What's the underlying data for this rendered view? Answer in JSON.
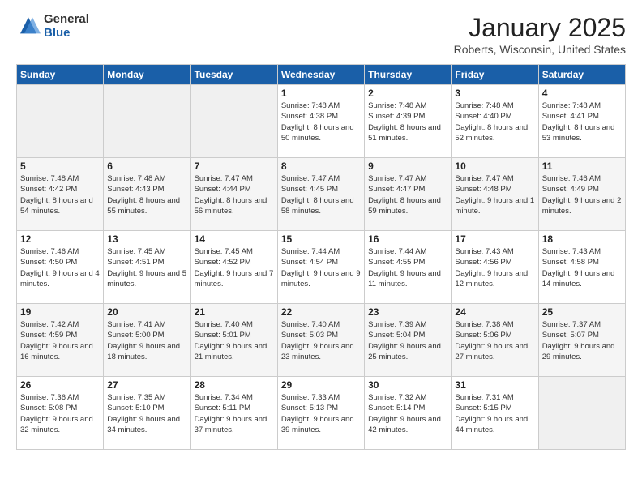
{
  "logo": {
    "general": "General",
    "blue": "Blue"
  },
  "header": {
    "month": "January 2025",
    "location": "Roberts, Wisconsin, United States"
  },
  "weekdays": [
    "Sunday",
    "Monday",
    "Tuesday",
    "Wednesday",
    "Thursday",
    "Friday",
    "Saturday"
  ],
  "weeks": [
    [
      {
        "day": "",
        "sunrise": "",
        "sunset": "",
        "daylight": ""
      },
      {
        "day": "",
        "sunrise": "",
        "sunset": "",
        "daylight": ""
      },
      {
        "day": "",
        "sunrise": "",
        "sunset": "",
        "daylight": ""
      },
      {
        "day": "1",
        "sunrise": "Sunrise: 7:48 AM",
        "sunset": "Sunset: 4:38 PM",
        "daylight": "Daylight: 8 hours and 50 minutes."
      },
      {
        "day": "2",
        "sunrise": "Sunrise: 7:48 AM",
        "sunset": "Sunset: 4:39 PM",
        "daylight": "Daylight: 8 hours and 51 minutes."
      },
      {
        "day": "3",
        "sunrise": "Sunrise: 7:48 AM",
        "sunset": "Sunset: 4:40 PM",
        "daylight": "Daylight: 8 hours and 52 minutes."
      },
      {
        "day": "4",
        "sunrise": "Sunrise: 7:48 AM",
        "sunset": "Sunset: 4:41 PM",
        "daylight": "Daylight: 8 hours and 53 minutes."
      }
    ],
    [
      {
        "day": "5",
        "sunrise": "Sunrise: 7:48 AM",
        "sunset": "Sunset: 4:42 PM",
        "daylight": "Daylight: 8 hours and 54 minutes."
      },
      {
        "day": "6",
        "sunrise": "Sunrise: 7:48 AM",
        "sunset": "Sunset: 4:43 PM",
        "daylight": "Daylight: 8 hours and 55 minutes."
      },
      {
        "day": "7",
        "sunrise": "Sunrise: 7:47 AM",
        "sunset": "Sunset: 4:44 PM",
        "daylight": "Daylight: 8 hours and 56 minutes."
      },
      {
        "day": "8",
        "sunrise": "Sunrise: 7:47 AM",
        "sunset": "Sunset: 4:45 PM",
        "daylight": "Daylight: 8 hours and 58 minutes."
      },
      {
        "day": "9",
        "sunrise": "Sunrise: 7:47 AM",
        "sunset": "Sunset: 4:47 PM",
        "daylight": "Daylight: 8 hours and 59 minutes."
      },
      {
        "day": "10",
        "sunrise": "Sunrise: 7:47 AM",
        "sunset": "Sunset: 4:48 PM",
        "daylight": "Daylight: 9 hours and 1 minute."
      },
      {
        "day": "11",
        "sunrise": "Sunrise: 7:46 AM",
        "sunset": "Sunset: 4:49 PM",
        "daylight": "Daylight: 9 hours and 2 minutes."
      }
    ],
    [
      {
        "day": "12",
        "sunrise": "Sunrise: 7:46 AM",
        "sunset": "Sunset: 4:50 PM",
        "daylight": "Daylight: 9 hours and 4 minutes."
      },
      {
        "day": "13",
        "sunrise": "Sunrise: 7:45 AM",
        "sunset": "Sunset: 4:51 PM",
        "daylight": "Daylight: 9 hours and 5 minutes."
      },
      {
        "day": "14",
        "sunrise": "Sunrise: 7:45 AM",
        "sunset": "Sunset: 4:52 PM",
        "daylight": "Daylight: 9 hours and 7 minutes."
      },
      {
        "day": "15",
        "sunrise": "Sunrise: 7:44 AM",
        "sunset": "Sunset: 4:54 PM",
        "daylight": "Daylight: 9 hours and 9 minutes."
      },
      {
        "day": "16",
        "sunrise": "Sunrise: 7:44 AM",
        "sunset": "Sunset: 4:55 PM",
        "daylight": "Daylight: 9 hours and 11 minutes."
      },
      {
        "day": "17",
        "sunrise": "Sunrise: 7:43 AM",
        "sunset": "Sunset: 4:56 PM",
        "daylight": "Daylight: 9 hours and 12 minutes."
      },
      {
        "day": "18",
        "sunrise": "Sunrise: 7:43 AM",
        "sunset": "Sunset: 4:58 PM",
        "daylight": "Daylight: 9 hours and 14 minutes."
      }
    ],
    [
      {
        "day": "19",
        "sunrise": "Sunrise: 7:42 AM",
        "sunset": "Sunset: 4:59 PM",
        "daylight": "Daylight: 9 hours and 16 minutes."
      },
      {
        "day": "20",
        "sunrise": "Sunrise: 7:41 AM",
        "sunset": "Sunset: 5:00 PM",
        "daylight": "Daylight: 9 hours and 18 minutes."
      },
      {
        "day": "21",
        "sunrise": "Sunrise: 7:40 AM",
        "sunset": "Sunset: 5:01 PM",
        "daylight": "Daylight: 9 hours and 21 minutes."
      },
      {
        "day": "22",
        "sunrise": "Sunrise: 7:40 AM",
        "sunset": "Sunset: 5:03 PM",
        "daylight": "Daylight: 9 hours and 23 minutes."
      },
      {
        "day": "23",
        "sunrise": "Sunrise: 7:39 AM",
        "sunset": "Sunset: 5:04 PM",
        "daylight": "Daylight: 9 hours and 25 minutes."
      },
      {
        "day": "24",
        "sunrise": "Sunrise: 7:38 AM",
        "sunset": "Sunset: 5:06 PM",
        "daylight": "Daylight: 9 hours and 27 minutes."
      },
      {
        "day": "25",
        "sunrise": "Sunrise: 7:37 AM",
        "sunset": "Sunset: 5:07 PM",
        "daylight": "Daylight: 9 hours and 29 minutes."
      }
    ],
    [
      {
        "day": "26",
        "sunrise": "Sunrise: 7:36 AM",
        "sunset": "Sunset: 5:08 PM",
        "daylight": "Daylight: 9 hours and 32 minutes."
      },
      {
        "day": "27",
        "sunrise": "Sunrise: 7:35 AM",
        "sunset": "Sunset: 5:10 PM",
        "daylight": "Daylight: 9 hours and 34 minutes."
      },
      {
        "day": "28",
        "sunrise": "Sunrise: 7:34 AM",
        "sunset": "Sunset: 5:11 PM",
        "daylight": "Daylight: 9 hours and 37 minutes."
      },
      {
        "day": "29",
        "sunrise": "Sunrise: 7:33 AM",
        "sunset": "Sunset: 5:13 PM",
        "daylight": "Daylight: 9 hours and 39 minutes."
      },
      {
        "day": "30",
        "sunrise": "Sunrise: 7:32 AM",
        "sunset": "Sunset: 5:14 PM",
        "daylight": "Daylight: 9 hours and 42 minutes."
      },
      {
        "day": "31",
        "sunrise": "Sunrise: 7:31 AM",
        "sunset": "Sunset: 5:15 PM",
        "daylight": "Daylight: 9 hours and 44 minutes."
      },
      {
        "day": "",
        "sunrise": "",
        "sunset": "",
        "daylight": ""
      }
    ]
  ]
}
